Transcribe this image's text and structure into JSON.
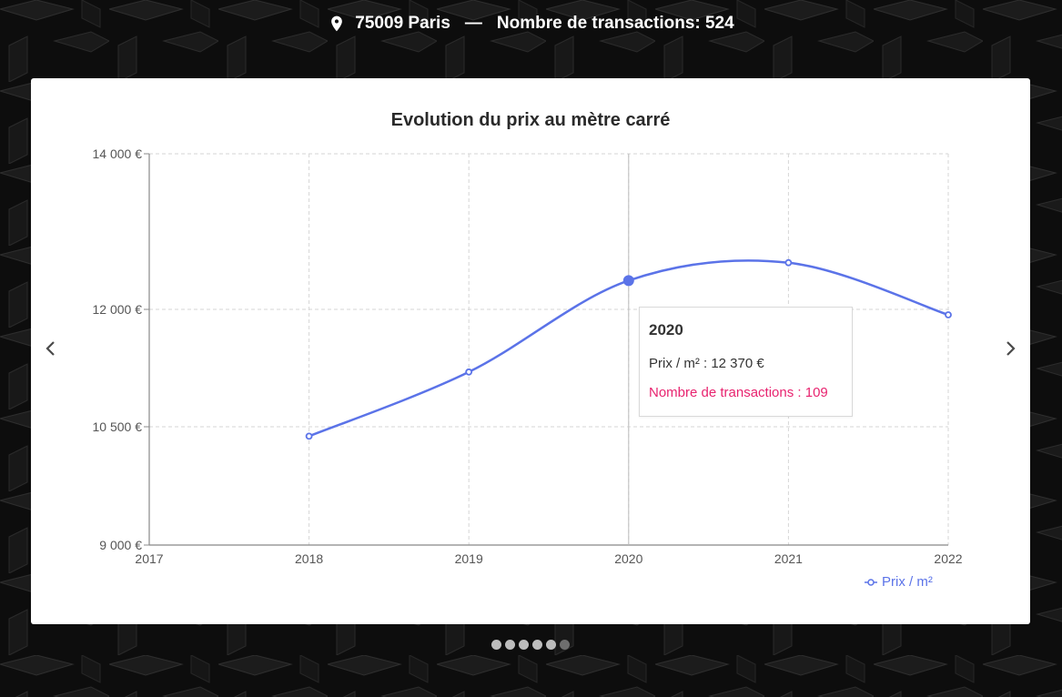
{
  "header": {
    "location": "75009 Paris",
    "separator": "—",
    "transactions_label": "Nombre de transactions: 524"
  },
  "chart_data": {
    "type": "line",
    "title": "Evolution du prix au mètre carré",
    "x": [
      2018,
      2019,
      2020,
      2021,
      2022
    ],
    "x_ticks": [
      "2017",
      "2018",
      "2019",
      "2020",
      "2021",
      "2022"
    ],
    "xlim": [
      2017,
      2022
    ],
    "y_ticks": [
      {
        "value": 9000,
        "label": "9 000 €"
      },
      {
        "value": 10500,
        "label": "10 500 €"
      },
      {
        "value": 12000,
        "label": "12 000 €"
      },
      {
        "value": 14000,
        "label": "14 000 €"
      }
    ],
    "ylim": [
      9000,
      14000
    ],
    "series": [
      {
        "name": "Prix / m²",
        "color": "#5b73e8",
        "values": [
          10380,
          11200,
          12370,
          12600,
          11930
        ]
      }
    ],
    "grid": true,
    "legend": "bottom-right",
    "highlighted_index": 2
  },
  "tooltip": {
    "year": "2020",
    "price": "Prix / m² : 12 370 €",
    "transactions": "Nombre de transactions : 109",
    "transactions_color": "#e8236f"
  },
  "legend": {
    "label": "Prix / m²"
  },
  "pagination": {
    "count": 6,
    "active": 5
  },
  "nav": {
    "prev_icon": "chevron-left-icon",
    "next_icon": "chevron-right-icon"
  }
}
